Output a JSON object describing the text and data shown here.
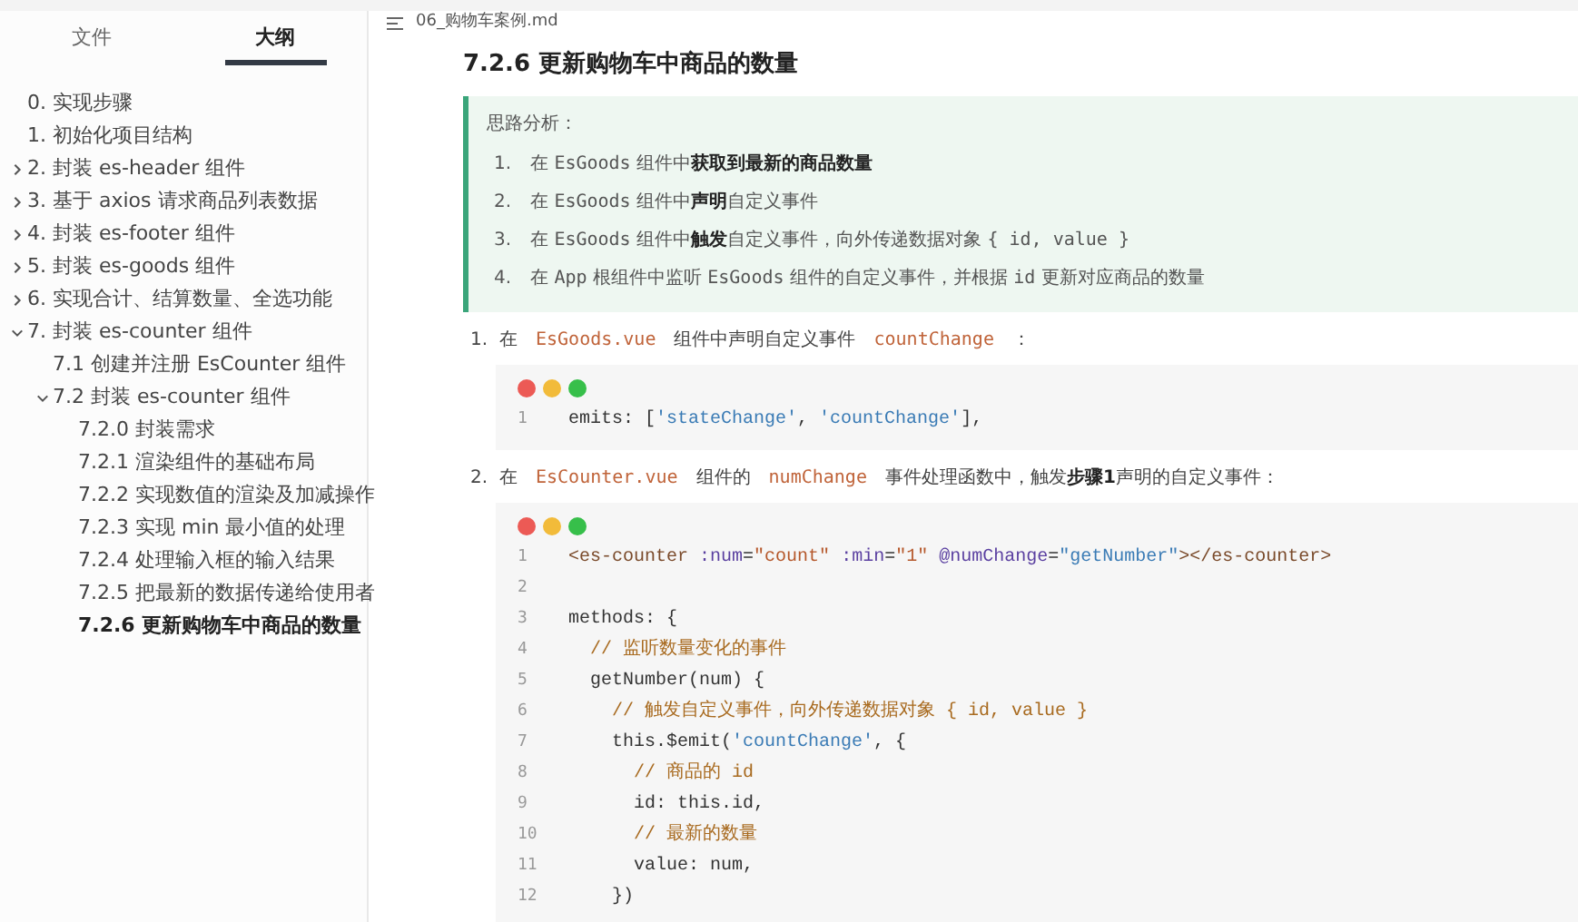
{
  "sidebar": {
    "tabs": [
      {
        "label": "文件",
        "selected": false
      },
      {
        "label": "大纲",
        "selected": true
      }
    ],
    "outline": [
      {
        "label": "0. 实现步骤",
        "selected": false
      },
      {
        "label": "1. 初始化项目结构",
        "selected": false
      },
      {
        "label": "2. 封装 es-header 组件",
        "selected": false,
        "expanded": false
      },
      {
        "label": "3. 基于 axios 请求商品列表数据",
        "selected": false,
        "expanded": false
      },
      {
        "label": "4. 封装 es-footer 组件",
        "selected": false,
        "expanded": false
      },
      {
        "label": "5. 封装 es-goods 组件",
        "selected": false,
        "expanded": false
      },
      {
        "label": "6. 实现合计、结算数量、全选功能",
        "selected": false,
        "expanded": false
      },
      {
        "label": "7. 封装 es-counter 组件",
        "selected": false,
        "expanded": true,
        "children": [
          {
            "label": "7.1 创建并注册 EsCounter 组件",
            "selected": false
          },
          {
            "label": "7.2 封装 es-counter 组件",
            "selected": false,
            "expanded": true,
            "children": [
              {
                "label": "7.2.0 封装需求",
                "selected": false
              },
              {
                "label": "7.2.1 渲染组件的基础布局",
                "selected": false
              },
              {
                "label": "7.2.2 实现数值的渲染及加减操作",
                "selected": false
              },
              {
                "label": "7.2.3 实现 min 最小值的处理",
                "selected": false
              },
              {
                "label": "7.2.4 处理输入框的输入结果",
                "selected": false
              },
              {
                "label": "7.2.5 把最新的数据传递给使用者",
                "selected": false
              },
              {
                "label": "7.2.6 更新购物车中商品的数量",
                "selected": true
              }
            ]
          }
        ]
      }
    ]
  },
  "file_title": "06_购物车案例.md",
  "heading": "7.2.6 更新购物车中商品的数量",
  "tip": {
    "title": "思路分析：",
    "items": [
      {
        "num": "1.",
        "segments": [
          {
            "kind": "text",
            "t": "在 "
          },
          {
            "kind": "mono",
            "t": "EsGoods"
          },
          {
            "kind": "text",
            "t": " 组件中"
          },
          {
            "kind": "bold",
            "t": "获取到最新的商品数量"
          }
        ]
      },
      {
        "num": "2.",
        "segments": [
          {
            "kind": "text",
            "t": "在 "
          },
          {
            "kind": "mono",
            "t": "EsGoods"
          },
          {
            "kind": "text",
            "t": " 组件中"
          },
          {
            "kind": "bold",
            "t": "声明"
          },
          {
            "kind": "text",
            "t": "自定义事件"
          }
        ]
      },
      {
        "num": "3.",
        "segments": [
          {
            "kind": "text",
            "t": "在 "
          },
          {
            "kind": "mono",
            "t": "EsGoods"
          },
          {
            "kind": "text",
            "t": " 组件中"
          },
          {
            "kind": "bold",
            "t": "触发"
          },
          {
            "kind": "text",
            "t": "自定义事件，向外传递数据对象 "
          },
          {
            "kind": "mono",
            "t": "{ id, value }"
          }
        ]
      },
      {
        "num": "4.",
        "segments": [
          {
            "kind": "text",
            "t": "在 "
          },
          {
            "kind": "mono",
            "t": "App"
          },
          {
            "kind": "text",
            "t": " 根组件中监听 "
          },
          {
            "kind": "mono",
            "t": "EsGoods"
          },
          {
            "kind": "text",
            "t": " 组件的自定义事件，并根据 "
          },
          {
            "kind": "mono",
            "t": "id"
          },
          {
            "kind": "text",
            "t": " 更新对应商品的数量"
          }
        ]
      }
    ]
  },
  "steps": [
    {
      "num": "1.",
      "segments": [
        {
          "kind": "text",
          "t": "在"
        },
        {
          "kind": "code",
          "t": "EsGoods.vue"
        },
        {
          "kind": "text",
          "t": "组件中声明自定义事件"
        },
        {
          "kind": "code",
          "t": "countChange"
        },
        {
          "kind": "text",
          "t": "："
        }
      ],
      "code": [
        {
          "n": "1",
          "tokens": [
            {
              "kind": "plain",
              "t": "emits: ["
            },
            {
              "kind": "str",
              "t": "'stateChange'"
            },
            {
              "kind": "plain",
              "t": ", "
            },
            {
              "kind": "str",
              "t": "'countChange'"
            },
            {
              "kind": "plain",
              "t": "],"
            }
          ]
        }
      ]
    },
    {
      "num": "2.",
      "segments": [
        {
          "kind": "text",
          "t": "在"
        },
        {
          "kind": "code",
          "t": "EsCounter.vue"
        },
        {
          "kind": "text",
          "t": "组件的"
        },
        {
          "kind": "code",
          "t": "numChange"
        },
        {
          "kind": "text",
          "t": "事件处理函数中，触发"
        },
        {
          "kind": "bold",
          "t": "步骤1"
        },
        {
          "kind": "text",
          "t": "声明的自定义事件："
        }
      ],
      "code": [
        {
          "n": "1",
          "tokens": [
            {
              "kind": "tag",
              "t": "<es-counter"
            },
            {
              "kind": "attr",
              "t": " :num"
            },
            {
              "kind": "plain",
              "t": "="
            },
            {
              "kind": "val",
              "t": "\"count\""
            },
            {
              "kind": "attr",
              "t": " :min"
            },
            {
              "kind": "plain",
              "t": "="
            },
            {
              "kind": "val",
              "t": "\"1\""
            },
            {
              "kind": "attr",
              "t": " @numChange"
            },
            {
              "kind": "plain",
              "t": "="
            },
            {
              "kind": "str",
              "t": "\"getNumber\""
            },
            {
              "kind": "tag",
              "t": "></es-counter>"
            }
          ]
        },
        {
          "n": "2"
        },
        {
          "n": "3",
          "tokens": [
            {
              "kind": "plain",
              "t": "methods: {"
            }
          ]
        },
        {
          "n": "4",
          "tokens": [
            {
              "kind": "comment",
              "t": "  // 监听数量变化的事件"
            }
          ]
        },
        {
          "n": "5",
          "tokens": [
            {
              "kind": "plain",
              "t": "  getNumber(num) {"
            }
          ]
        },
        {
          "n": "6",
          "tokens": [
            {
              "kind": "comment",
              "t": "    // 触发自定义事件，向外传递数据对象 { id, value }"
            }
          ]
        },
        {
          "n": "7",
          "tokens": [
            {
              "kind": "plain",
              "t": "    this.$emit("
            },
            {
              "kind": "str",
              "t": "'countChange'"
            },
            {
              "kind": "plain",
              "t": ", {"
            }
          ]
        },
        {
          "n": "8",
          "tokens": [
            {
              "kind": "comment",
              "t": "      // 商品的 id"
            }
          ]
        },
        {
          "n": "9",
          "tokens": [
            {
              "kind": "plain",
              "t": "      id: this.id,"
            }
          ]
        },
        {
          "n": "10",
          "tokens": [
            {
              "kind": "comment",
              "t": "      // 最新的数量"
            }
          ]
        },
        {
          "n": "11",
          "tokens": [
            {
              "kind": "plain",
              "t": "      value: num,"
            }
          ]
        },
        {
          "n": "12",
          "tokens": [
            {
              "kind": "plain",
              "t": "    })"
            }
          ]
        }
      ]
    }
  ]
}
